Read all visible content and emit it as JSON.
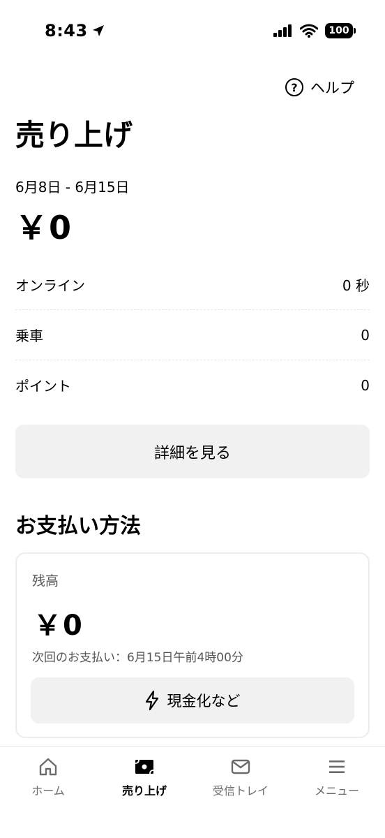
{
  "status_bar": {
    "time": "8:43",
    "battery": "100"
  },
  "header": {
    "help_label": "ヘルプ"
  },
  "earnings": {
    "title": "売り上げ",
    "date_range": "6月8日 - 6月15日",
    "total": "￥0",
    "stats": [
      {
        "label": "オンライン",
        "value": "0 秒"
      },
      {
        "label": "乗車",
        "value": "0"
      },
      {
        "label": "ポイント",
        "value": "0"
      }
    ],
    "details_button": "詳細を見る"
  },
  "payments": {
    "title": "お支払い方法",
    "balance_label": "残高",
    "balance_amount": "￥0",
    "next_payout": "次回のお支払い：6月15日午前4時00分",
    "cashout_button": "現金化など"
  },
  "tabbar": {
    "items": [
      {
        "label": "ホーム",
        "icon": "home-icon",
        "active": false
      },
      {
        "label": "売り上げ",
        "icon": "earnings-icon",
        "active": true
      },
      {
        "label": "受信トレイ",
        "icon": "inbox-icon",
        "active": false
      },
      {
        "label": "メニュー",
        "icon": "menu-icon",
        "active": false
      }
    ]
  }
}
